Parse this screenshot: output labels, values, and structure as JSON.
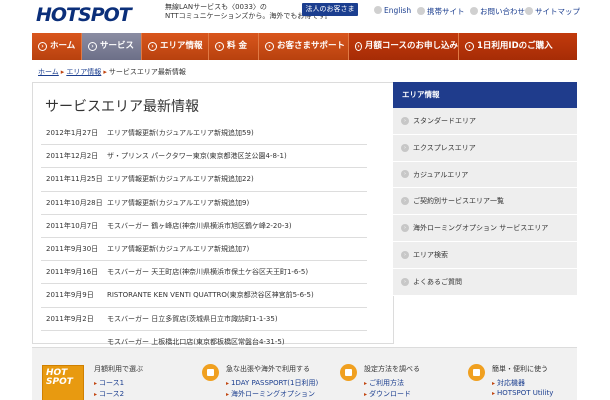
{
  "header": {
    "logo": "HOTSPOT",
    "tagline": "無線LANサービスも〈0033〉の\nNTTコミュニケーションズから。海外でもお得です。",
    "business_button": "法人のお客さま",
    "english": "English",
    "mobile": "携帯サイト",
    "contact": "お問い合わせ",
    "sitemap": "サイトマップ"
  },
  "nav": {
    "home": "ホーム",
    "service": "サービス",
    "area": "エリア情報",
    "fee": "料 金",
    "support": "お客さまサポート",
    "monthly": "月額コースのお申し込み",
    "oneday": "1日利用IDのご購入"
  },
  "breadcrumb": {
    "home": "ホーム",
    "area": "エリア情報",
    "current": "サービスエリア最新情報"
  },
  "main": {
    "title": "サービスエリア最新情報",
    "news": [
      {
        "date": "2012年1月27日",
        "text": "エリア情報更新(カジュアルエリア新規追加59)"
      },
      {
        "date": "2011年12月2日",
        "text": "ザ・プリンス パークタワー東京(東京都港区芝公園4-8-1)"
      },
      {
        "date": "2011年11月25日",
        "text": "エリア情報更新(カジュアルエリア新規追加22)"
      },
      {
        "date": "2011年10月28日",
        "text": "エリア情報更新(カジュアルエリア新規追加9)"
      },
      {
        "date": "2011年10月7日",
        "text": "モスバーガー 鶴ヶ峰店(神奈川県横浜市旭区鶴ケ峰2-20-3)"
      },
      {
        "date": "2011年9月30日",
        "text": "エリア情報更新(カジュアルエリア新規追加7)"
      },
      {
        "date": "2011年9月16日",
        "text": "モスバーガー 天王町店(神奈川県横浜市保土ケ谷区天王町1-6-5)"
      },
      {
        "date": "2011年9月9日",
        "text": "RISTORANTE KEN VENTI QUATTRO(東京都渋谷区神宮前5-6-5)"
      },
      {
        "date": "2011年9月2日",
        "text": "モスバーガー 日立多賀店(茨城県日立市諏訪町1-1-35)"
      },
      {
        "date": "",
        "text": "モスバーガー 上板橋北口店(東京都板橋区常盤台4-31-5)"
      }
    ]
  },
  "sidebar": {
    "heading": "エリア情報",
    "items": [
      "スタンダードエリア",
      "エクスプレスエリア",
      "カジュアルエリア",
      "ご契約別サービスエリア一覧",
      "海外ローミングオプション サービスエリア",
      "エリア検索",
      "よくあるご質問"
    ]
  },
  "footer": {
    "col1": {
      "thumb_hot": "HOT",
      "thumb_spot": "SPOT",
      "title": "月額利用で選ぶ",
      "links": [
        "コース1",
        "コース2"
      ]
    },
    "col2": {
      "title": "急な出張や海外で利用する",
      "links": [
        "1DAY PASSPORT(1日利用)",
        "海外ローミングオプション"
      ]
    },
    "col3": {
      "title": "設定方法を調べる",
      "links": [
        "ご利用方法",
        "ダウンロード"
      ]
    },
    "col4": {
      "title": "簡単・便利に使う",
      "links": [
        "対応機器",
        "HOTSPOT Utility"
      ]
    }
  }
}
